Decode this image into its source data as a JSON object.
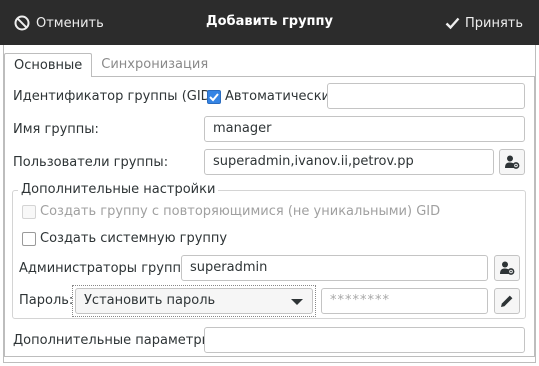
{
  "header": {
    "cancel_label": "Отменить",
    "title": "Добавить группу",
    "accept_label": "Принять"
  },
  "tabs": [
    {
      "label": "Основные",
      "active": true
    },
    {
      "label": "Синхронизация",
      "active": false
    }
  ],
  "form": {
    "gid_label": "Идентификатор группы (GID):",
    "auto_label": "Автоматически",
    "auto_checked": true,
    "gid_value": "",
    "name_label": "Имя группы:",
    "name_value": "manager",
    "users_label": "Пользователи группы:",
    "users_value": "superadmin,ivanov.ii,petrov.pp",
    "extra_section": "Дополнительные настройки",
    "duplicate_label": "Создать группу с повторяющимися (не уникальными) GID",
    "duplicate_checked": false,
    "system_label": "Создать системную группу",
    "system_checked": false,
    "admins_label": "Администраторы группы:",
    "admins_value": "superadmin",
    "password_label": "Пароль:",
    "password_option": "Установить пароль",
    "password_placeholder": "********",
    "params_label": "Дополнительные параметры:",
    "params_value": ""
  },
  "icons": {
    "cancel": "no-entry-icon",
    "accept": "checkmark-icon",
    "users_picker": "user-gear-icon",
    "admins_picker": "user-gear-icon",
    "edit_password": "pencil-icon"
  },
  "colors": {
    "header_bg": "#2c2c2c",
    "accent": "#3584e4"
  }
}
